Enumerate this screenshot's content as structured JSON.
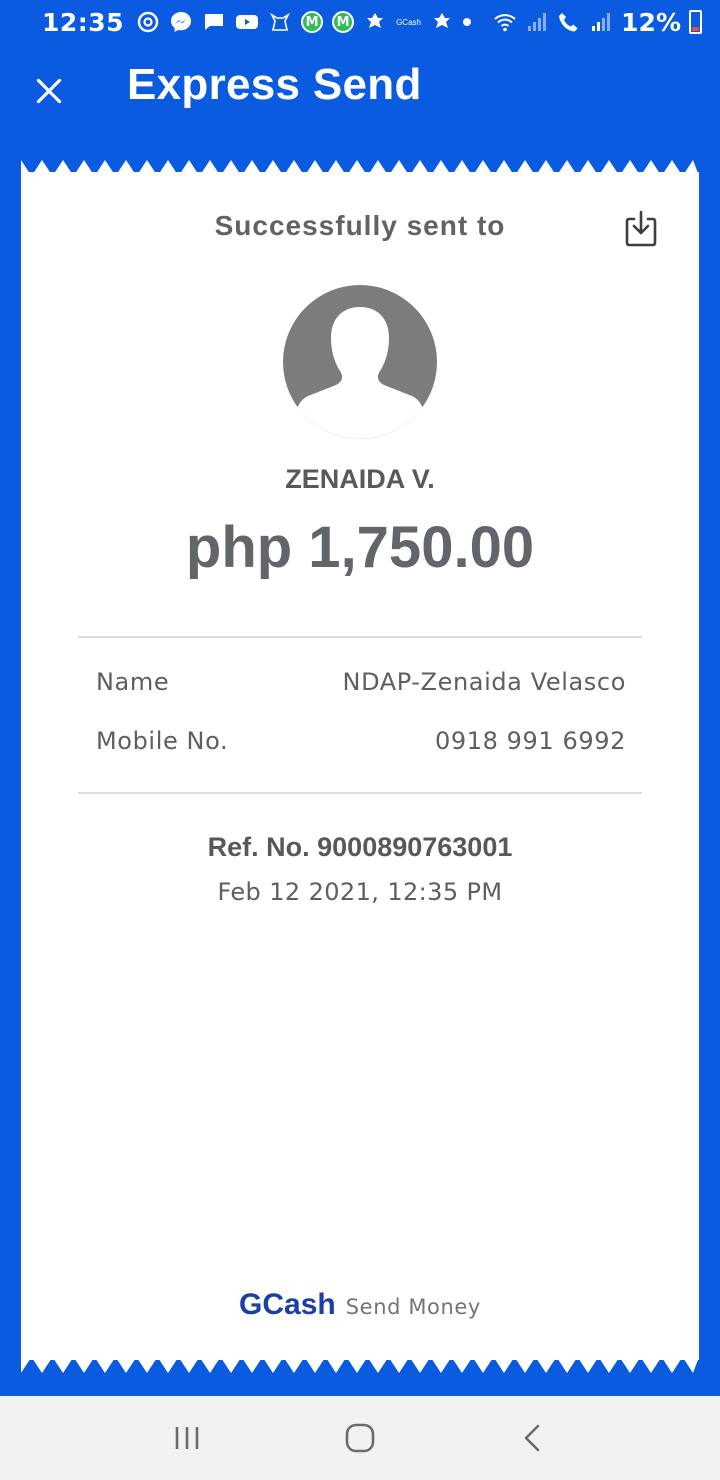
{
  "status_bar": {
    "time": "12:35",
    "gcash_label": "GCash",
    "m_badge_1": "M",
    "m_badge_2": "M",
    "battery": "12%"
  },
  "header": {
    "title": "Express Send",
    "close_icon": "close-icon"
  },
  "receipt": {
    "success_label": "Successfully sent to",
    "download_icon": "download-icon",
    "recipient_short": "ZENAIDA V.",
    "amount": "php 1,750.00",
    "details": [
      {
        "label": "Name",
        "value": "NDAP-Zenaida Velasco"
      },
      {
        "label": "Mobile No.",
        "value": "0918 991 6992"
      }
    ],
    "ref_no": "Ref. No. 9000890763001",
    "date": "Feb 12 2021, 12:35 PM",
    "footer_brand": "GCash",
    "footer_sub": "Send Money"
  },
  "colors": {
    "brand_blue": "#0a5be0",
    "brand_text": "#1a3fa6",
    "m_badge": "#2ebd59"
  },
  "nav": {
    "recent_icon": "recent-apps-icon",
    "home_icon": "home-icon",
    "back_icon": "back-icon"
  }
}
